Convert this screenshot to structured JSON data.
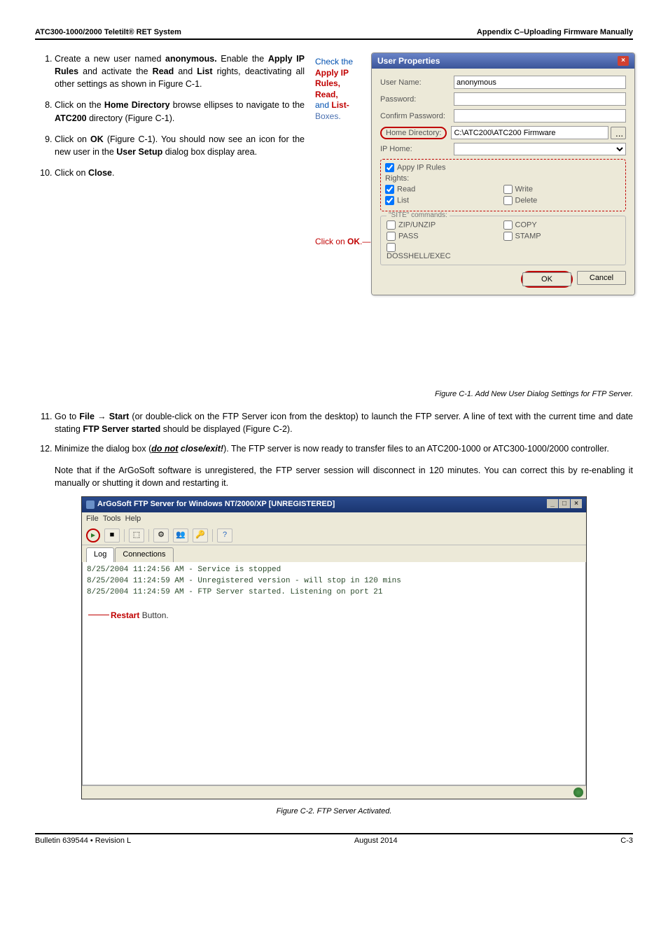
{
  "hdr": {
    "left": "ATC300-1000/2000 Teletilt® RET System",
    "right": "Appendix C–Uploading Firmware Manually"
  },
  "steps": {
    "s1": "Create a new user named ",
    "s1b": "anonymous.",
    "s1c": " Enable the ",
    "s1d": "Apply IP Rules",
    "s1e": " and activate the ",
    "s1f": "Read",
    "s1g": " and ",
    "s1h": "List",
    "s1i": " rights, deactivating all other settings as shown in Figure C-1.",
    "s8a": "Click on the ",
    "s8b": "Home Directory",
    "s8c": " browse ellipses to navigate to the ",
    "s8d": "ATC200",
    "s8e": " directory (Figure C-1).",
    "s9a": "Click on ",
    "s9b": "OK",
    "s9c": " (Figure C-1). You should now see an icon for the new user in the ",
    "s9d": "User Setup",
    "s9e": " dialog box display area.",
    "s10a": "Click on ",
    "s10b": "Close",
    "s10c": "."
  },
  "label": {
    "check": "Check the",
    "apply": "Apply IP Rules,",
    "read": "Read,",
    "and": "and ",
    "list": "List-",
    "boxes": "Boxes.",
    "clickok": "Click on ",
    "ok": "OK",
    "dot": "."
  },
  "dlg": {
    "title": "User Properties",
    "un": "User Name:",
    "unv": "anonymous",
    "pw": "Password:",
    "cpw": "Confirm Password:",
    "hd": "Home Directory:",
    "hdv": "C:\\ATC200\\ATC200 Firmware",
    "iph": "IP Home:",
    "air": "Appy IP Rules",
    "rights": "Rights:",
    "read": "Read",
    "write": "Write",
    "list": "List",
    "delete": "Delete",
    "site": "\"SITE\" commands:",
    "zip": "ZIP/UNZIP",
    "copy": "COPY",
    "pass": "PASS",
    "stamp": "STAMP",
    "dos": "DOSSHELL/EXEC",
    "ok": "OK",
    "cancel": "Cancel"
  },
  "fig1": "Figure C-1. Add New User Dialog Settings for FTP Server.",
  "lower": {
    "s11a": "Go to ",
    "s11b": "File",
    "s11arrow": " → ",
    "s11c": "Start",
    "s11d": " (or double-click on the FTP Server icon from the desktop) to launch the FTP server. A line of text with the current time and date stating ",
    "s11e": "FTP Server started",
    "s11f": " should be displayed (Figure C-2).",
    "s12a": "Minimize the dialog box (",
    "s12b": "do not",
    "s12c": " close/exit!",
    "s12d": "). The FTP server is now ready to transfer files to an ATC200-1000 or ATC300-1000/2000 controller.",
    "note": "Note that if the ArGoSoft software is unregistered, the FTP server session will disconnect in 120 minutes. You can correct this by re-enabling it manually or shutting it down and restarting it."
  },
  "app": {
    "title": "ArGoSoft FTP Server for Windows NT/2000/XP [UNREGISTERED]",
    "file": "File",
    "tools": "Tools",
    "help": "Help",
    "log": "Log",
    "conn": "Connections",
    "line1": "8/25/2004 11:24:56 AM - Service is stopped",
    "line2": "8/25/2004 11:24:59 AM - Unregistered version - will stop in 120 mins",
    "line3": "8/25/2004 11:24:59 AM - FTP Server started. Listening on port 21",
    "restart": "Restart",
    "restartb": " Button."
  },
  "fig2": "Figure C-2. FTP Server Activated.",
  "ftr": {
    "left": "Bulletin 639544  •  Revision L",
    "mid": "August 2014",
    "right": "C-3"
  }
}
